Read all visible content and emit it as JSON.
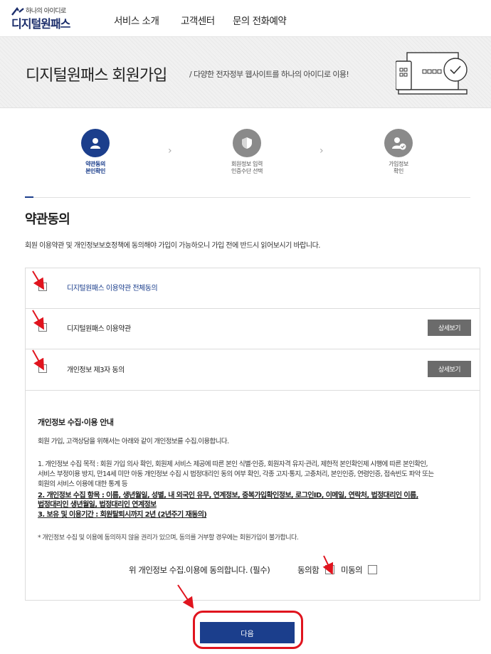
{
  "header": {
    "logo_small": "하나의 아이디로",
    "logo_big": "디지털원패스",
    "nav": [
      "서비스 소개",
      "고객센터",
      "문의 전화예약"
    ]
  },
  "hero": {
    "title": "디지털원패스 회원가입",
    "subtitle": "/ 다양한 전자정부 웹사이트를 하나의 아이디로 이용!"
  },
  "steps": [
    {
      "label": "약관동의\n본인확인",
      "icon": "user-icon",
      "active": true
    },
    {
      "label": "회원정보 입력\n인증수단 선택",
      "icon": "shield-icon",
      "active": false
    },
    {
      "label": "가입정보\n확인",
      "icon": "user-check-icon",
      "active": false
    }
  ],
  "section": {
    "title": "약관동의",
    "intro": "회원 이용약관 및 개인정보보호정책에 동의해야 가입이 가능하오니 가입 전에 반드시 읽어보시기 바랍니다."
  },
  "terms": {
    "all": "디지털원패스 이용약관 전체동의",
    "items": [
      {
        "label": "디지털원패스 이용약관",
        "button": "상세보기"
      },
      {
        "label": "개인정보 제3자 동의",
        "button": "상세보기"
      }
    ]
  },
  "privacy": {
    "title": "개인정보 수집·이용 안내",
    "lead": "회원 가입, 고객상담을 위해서는 아래와 같이 개인정보를 수집.이용합니다.",
    "purpose_lines": [
      "1. 개인정보 수집 목적 : 회원 가입 의사 확인, 회원제 서비스 제공에 따른 본인 식별·인증, 회원자격 유지·관리, 제한적 본인확인제 시행에 따른 본인확인,",
      "서비스 부정이용 방지, 만14세 미만 아동 개인정보 수집 시 법정대리인 동의 여부 확인, 각종 고지·통지, 고충처리, 본인인증, 연령인증, 접속빈도 파악 또는",
      "회원의 서비스 이용에 대한 통계 등"
    ],
    "items_lines": [
      "2. 개인정보 수집 항목 : 이름, 생년월일, 성별, 내 외국인 유무, 연계정보, 중복가입확인정보, 로그인ID, 이메일, 연락처, 법정대리인 이름,",
      "법정대리인 생년월일, 법정대리인 연계정보"
    ],
    "period": "3. 보유 및 이용기간 : 회원탈퇴시까지 2년 (2년주기 재동의)",
    "note": "* 개인정보 수집 및 이용에 동의하지 않을 권리가 있으며, 동의를 거부할 경우에는 회원가입이 불가합니다.",
    "question": "위 개인정보 수집.이용에 동의합니다. (필수)",
    "agree": "동의함",
    "disagree": "미동의"
  },
  "next_button": "다음",
  "colors": {
    "primary": "#1b3e8c",
    "annotation": "#e0141e",
    "detail_button": "#6b6b6b"
  }
}
